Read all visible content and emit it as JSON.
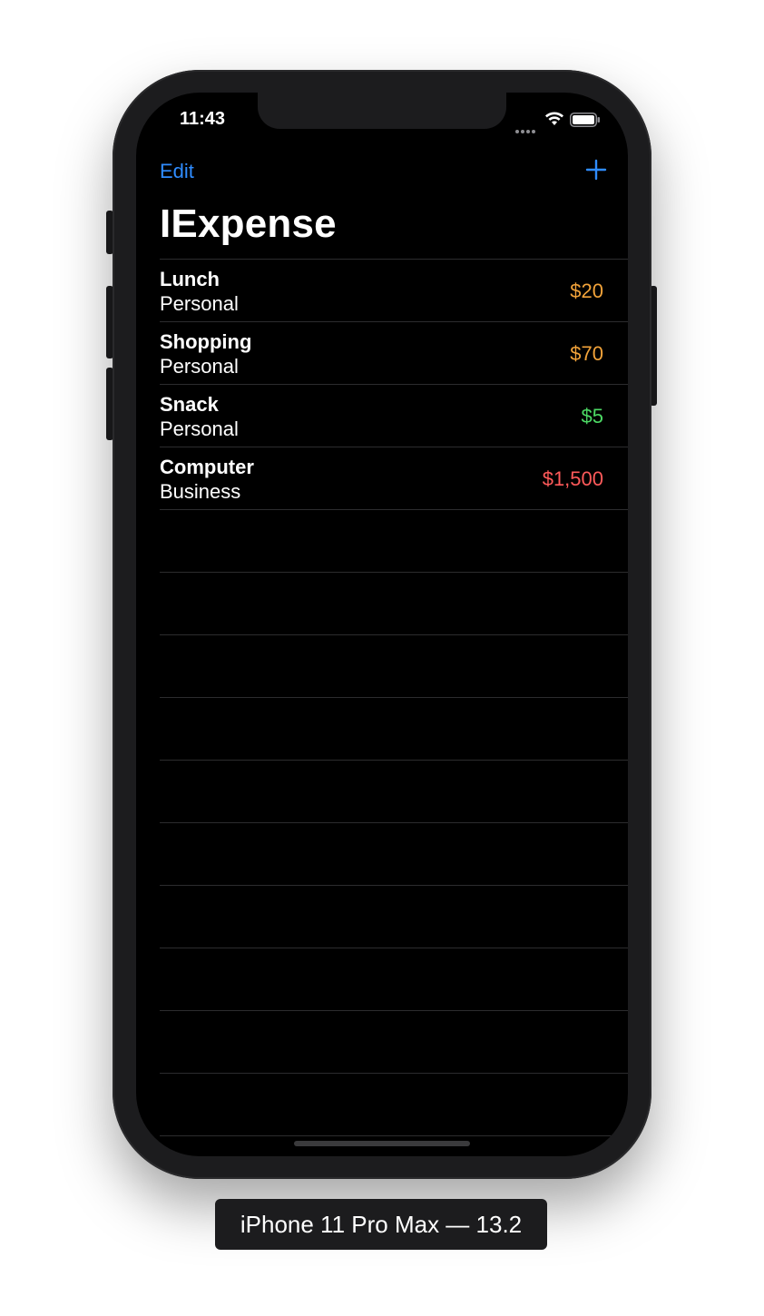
{
  "status_bar": {
    "time": "11:43"
  },
  "nav": {
    "edit_label": "Edit",
    "add_icon": "plus-icon",
    "title": "IExpense"
  },
  "expenses": [
    {
      "name": "Lunch",
      "type": "Personal",
      "amount": "$20",
      "amount_color": "#f2a33a"
    },
    {
      "name": "Shopping",
      "type": "Personal",
      "amount": "$70",
      "amount_color": "#f2a33a"
    },
    {
      "name": "Snack",
      "type": "Personal",
      "amount": "$5",
      "amount_color": "#4cd964"
    },
    {
      "name": "Computer",
      "type": "Business",
      "amount": "$1,500",
      "amount_color": "#ff5a5a"
    }
  ],
  "device_label": "iPhone 11 Pro Max — 13.2",
  "colors": {
    "accent": "#2f8cff",
    "background": "#000000",
    "separator": "#2c2c2e"
  }
}
